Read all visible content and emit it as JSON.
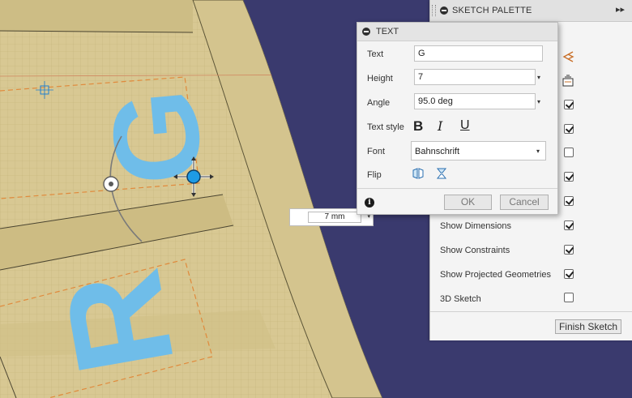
{
  "palette": {
    "title": "SKETCH PALETTE",
    "expand_glyph": "▸▸",
    "rows": [
      {
        "label": "Show Dimensions",
        "checked": true
      },
      {
        "label": "Show Constraints",
        "checked": true
      },
      {
        "label": "Show Projected Geometries",
        "checked": true
      },
      {
        "label": "3D Sketch",
        "checked": false
      }
    ],
    "hidden_checks": [
      true,
      true,
      false,
      true,
      true
    ],
    "finish_label": "Finish Sketch"
  },
  "dialog": {
    "title": "TEXT",
    "text_label": "Text",
    "text_value": "G",
    "height_label": "Height",
    "height_value": "7",
    "angle_label": "Angle",
    "angle_value": "95.0 deg",
    "style_label": "Text style",
    "bold_glyph": "B",
    "italic_glyph": "I",
    "underline_glyph": "U",
    "font_label": "Font",
    "font_value": "Bahnschrift",
    "flip_label": "Flip",
    "info_glyph": "i",
    "ok_label": "OK",
    "cancel_label": "Cancel"
  },
  "canvas": {
    "dimension_value": "7 mm",
    "dropdown_glyph": "▾",
    "sketch_letters": [
      "G",
      "R"
    ],
    "colors": {
      "background": "#3a3a6e",
      "ring": "#d4c48e",
      "text_fill": "#6fbde9",
      "handle": "#1e9be6",
      "constraint_line": "#e08a3c"
    }
  }
}
